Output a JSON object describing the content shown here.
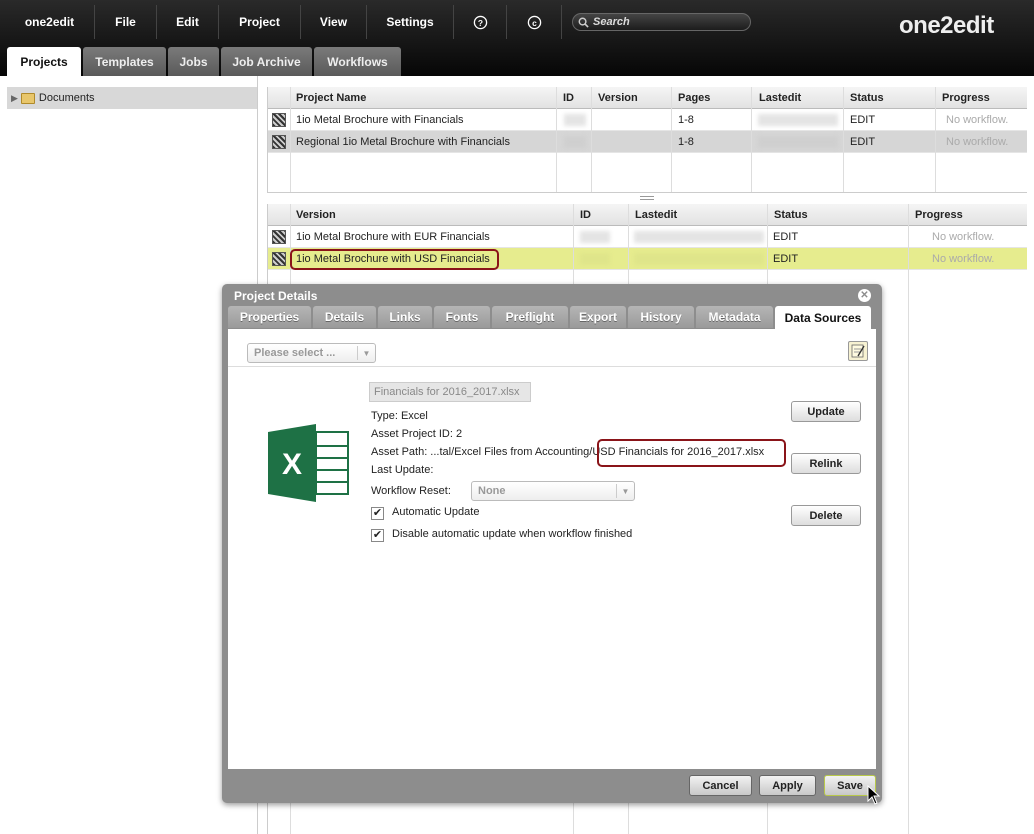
{
  "menu": {
    "app": "one2edit",
    "file": "File",
    "edit": "Edit",
    "project": "Project",
    "view": "View",
    "settings": "Settings"
  },
  "search": {
    "placeholder": "Search"
  },
  "logo": "one2edit",
  "tabs": [
    "Projects",
    "Templates",
    "Jobs",
    "Job Archive",
    "Workflows"
  ],
  "tree": {
    "root": "Documents"
  },
  "projects": {
    "columns": [
      "Project Name",
      "ID",
      "Version",
      "Pages",
      "Lastedit",
      "Status",
      "Progress"
    ],
    "rows": [
      {
        "name": "1io Metal Brochure with Financials",
        "pages": "1-8",
        "status": "EDIT",
        "progress": "No workflow."
      },
      {
        "name": "Regional 1io Metal Brochure with Financials",
        "pages": "1-8",
        "status": "EDIT",
        "progress": "No workflow."
      }
    ]
  },
  "versions": {
    "columns": [
      "Version",
      "ID",
      "Lastedit",
      "Status",
      "Progress"
    ],
    "rows": [
      {
        "name": "1io Metal Brochure with EUR Financials",
        "status": "EDIT",
        "progress": "No workflow."
      },
      {
        "name": "1io Metal Brochure with USD Financials",
        "status": "EDIT",
        "progress": "No workflow."
      }
    ]
  },
  "dialog": {
    "title": "Project Details",
    "tabs": [
      "Properties",
      "Details",
      "Links",
      "Fonts",
      "Preflight",
      "Export",
      "History",
      "Metadata",
      "Data Sources"
    ],
    "select_placeholder": "Please select ...",
    "file_name": "Financials for 2016_2017.xlsx",
    "type": "Type: Excel",
    "asset_project_id": "Asset Project ID: 2",
    "asset_path_prefix": "Asset Path: ...tal/Excel Files from Accounting/",
    "asset_path_file": "USD Financials for 2016_2017.xlsx",
    "last_update": "Last Update:",
    "workflow_reset_label": "Workflow Reset:",
    "workflow_reset_value": "None",
    "auto_update": "Automatic Update",
    "disable_auto": "Disable automatic update when workflow finished",
    "buttons": {
      "update": "Update",
      "relink": "Relink",
      "delete": "Delete"
    },
    "footer": {
      "cancel": "Cancel",
      "apply": "Apply",
      "save": "Save"
    }
  },
  "colors": {
    "highlight_row": "#e6ec8e",
    "callout": "#8a1419",
    "excel_green": "#1e7145"
  }
}
